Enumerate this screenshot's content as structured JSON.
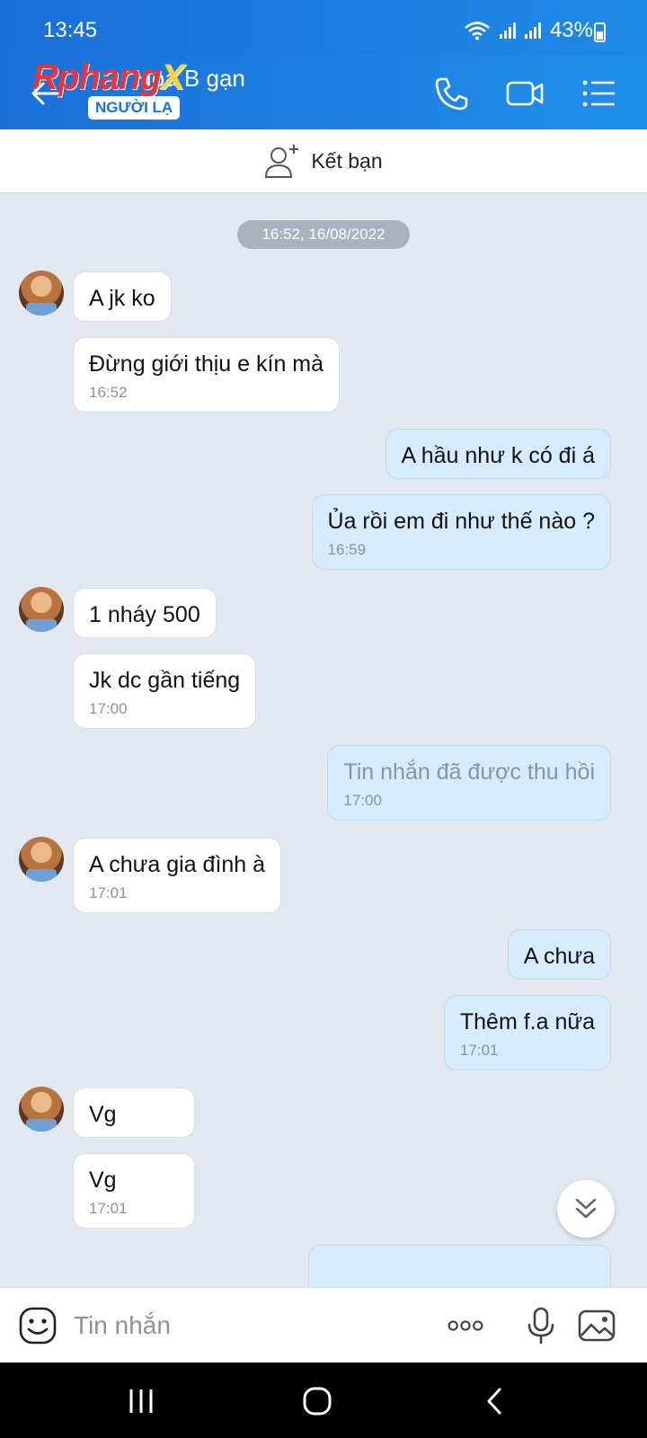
{
  "status": {
    "time": "13:45",
    "battery": "43%"
  },
  "header": {
    "contact_name": "Hoa B gạn",
    "badge": "NGƯỜI LẠ",
    "watermark": "Rphang X"
  },
  "add_friend": {
    "label": "Kết bạn"
  },
  "chat": {
    "date_separator": "16:52, 16/08/2022",
    "messages": [
      {
        "side": "in",
        "text": "A jk ko",
        "time": ""
      },
      {
        "side": "in",
        "text": "Đừng giới thịu e kín mà",
        "time": "16:52"
      },
      {
        "side": "out",
        "text": "A hầu như k có đi á",
        "time": ""
      },
      {
        "side": "out",
        "text": "Ủa rồi em đi như thế nào ?",
        "time": "16:59"
      },
      {
        "side": "in",
        "text": "1 nháy 500",
        "time": ""
      },
      {
        "side": "in",
        "text": "Jk dc gần tiếng",
        "time": "17:00"
      },
      {
        "side": "out",
        "text": "Tin nhắn đã được thu hồi",
        "time": "17:00"
      },
      {
        "side": "in",
        "text": "A chưa gia đình à",
        "time": "17:01"
      },
      {
        "side": "out",
        "text": "A chưa",
        "time": ""
      },
      {
        "side": "out",
        "text": "Thêm f.a nữa",
        "time": "17:01"
      },
      {
        "side": "in",
        "text": "Vg",
        "time": ""
      },
      {
        "side": "in",
        "text": "Vg",
        "time": "17:01"
      }
    ]
  },
  "composer": {
    "placeholder": "Tin nhắn"
  },
  "icons": {
    "back": "arrow-left-icon",
    "call": "phone-icon",
    "video": "video-camera-icon",
    "menu": "list-menu-icon",
    "add_friend": "add-user-icon",
    "emoji": "emoji-icon",
    "more": "more-dots-icon",
    "mic": "microphone-icon",
    "image": "image-icon",
    "scroll": "chevron-double-down-icon"
  },
  "colors": {
    "header": "#1f8ae6",
    "incoming": "#ffffff",
    "outgoing": "#d6ecfd",
    "background": "#e2e8f0"
  }
}
